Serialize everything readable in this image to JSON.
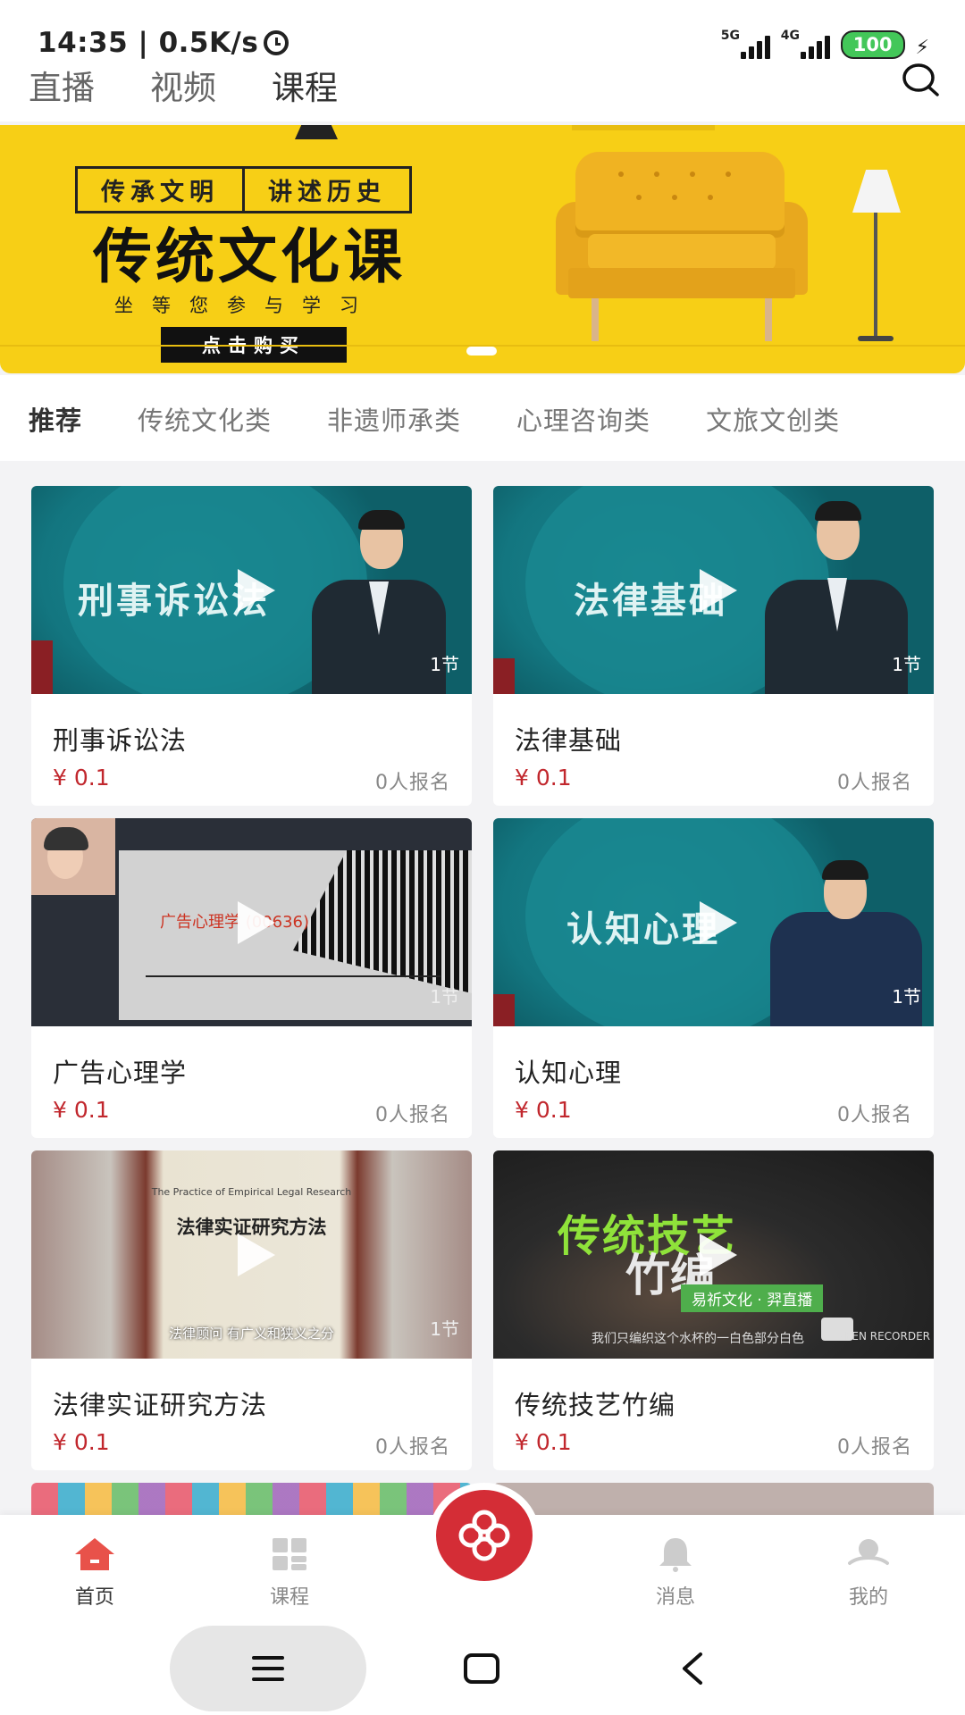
{
  "status": {
    "time": "14:35 | 0.5K/s",
    "net1": "5G",
    "net2": "4G",
    "battery": "100"
  },
  "top_tabs": [
    "直播",
    "视频",
    "课程"
  ],
  "banner": {
    "tag_left": "传承文明",
    "tag_right": "讲述历史",
    "headline": "传统文化课",
    "subline": "坐等您参与学习",
    "button": "点击购买"
  },
  "categories": [
    "推荐",
    "传统文化类",
    "非遗师承类",
    "心理咨询类",
    "文旅文创类"
  ],
  "courses": [
    {
      "title": "刑事诉讼法",
      "price": "¥ 0.1",
      "enroll": "0人报名",
      "thumb_text": "刑事诉讼法",
      "sections": "1节"
    },
    {
      "title": "法律基础",
      "price": "¥ 0.1",
      "enroll": "0人报名",
      "thumb_text": "法律基础",
      "sections": "1节"
    },
    {
      "title": "广告心理学",
      "price": "¥ 0.1",
      "enroll": "0人报名",
      "thumb_text": "广告心理学 (00636)",
      "sections": "1节"
    },
    {
      "title": "认知心理",
      "price": "¥ 0.1",
      "enroll": "0人报名",
      "thumb_text": "认知心理",
      "sections": "1节"
    },
    {
      "title": "法律实证研究方法",
      "price": "¥ 0.1",
      "enroll": "0人报名",
      "thumb_text": "法律实证研究方法",
      "thumb_small": "The Practice of Empirical Legal Research",
      "thumb_caption": "法律顾问 有广义和狭义之分",
      "sections": "1节"
    },
    {
      "title": "传统技艺竹编",
      "price": "¥ 0.1",
      "enroll": "0人报名",
      "thumb_text_1": "传统技艺",
      "thumb_text_2": "竹编",
      "thumb_tag": "易祈文化 · 羿直播",
      "thumb_caption": "我们只编织这个水杯的一白色部分白色",
      "thumb_rec": "SCREEN RECORDER"
    }
  ],
  "bottom_nav": [
    "首页",
    "课程",
    "消息",
    "我的"
  ],
  "colors": {
    "accent": "#d42d36",
    "price": "#c1272d",
    "banner": "#f7cf16",
    "nav_home": "#e8524a"
  }
}
